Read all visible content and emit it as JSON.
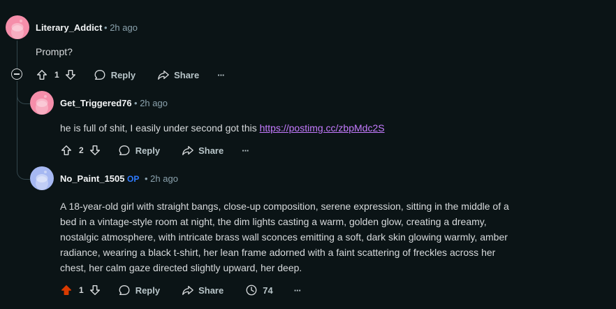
{
  "comments": [
    {
      "username": "Literary_Addict",
      "time": "2h ago",
      "text": "Prompt?",
      "votes": "1",
      "reply_label": "Reply",
      "share_label": "Share",
      "avatar_color": "#f58eaa"
    },
    {
      "username": "Get_Triggered76",
      "time": "2h ago",
      "text_prefix": "he is full of shit, I easily under second got this ",
      "link": "https://postimg.cc/zbpMdc2S",
      "votes": "2",
      "reply_label": "Reply",
      "share_label": "Share",
      "avatar_color": "#f58eaa"
    },
    {
      "username": "No_Paint_1505",
      "op_badge": "OP",
      "time": "2h ago",
      "text_lines": [
        "A 18-year-old girl with straight bangs, close-up composition, serene expression, sitting in the middle of a",
        "bed in a vintage-style room at night, the dim lights casting a warm, golden glow, creating a dreamy,",
        "nostalgic atmosphere, with intricate brass wall sconces emitting a soft, dark skin glowing warmly, amber",
        "radiance, wearing a black t-shirt, her lean frame adorned with a faint scattering of freckles across her",
        "chest, her calm gaze directed slightly upward, her deep."
      ],
      "votes": "1",
      "reply_label": "Reply",
      "share_label": "Share",
      "views": "74",
      "avatar_color": "#a6b8f2",
      "upvote_color": "#d93a00"
    }
  ],
  "separator": "•",
  "more": "···"
}
